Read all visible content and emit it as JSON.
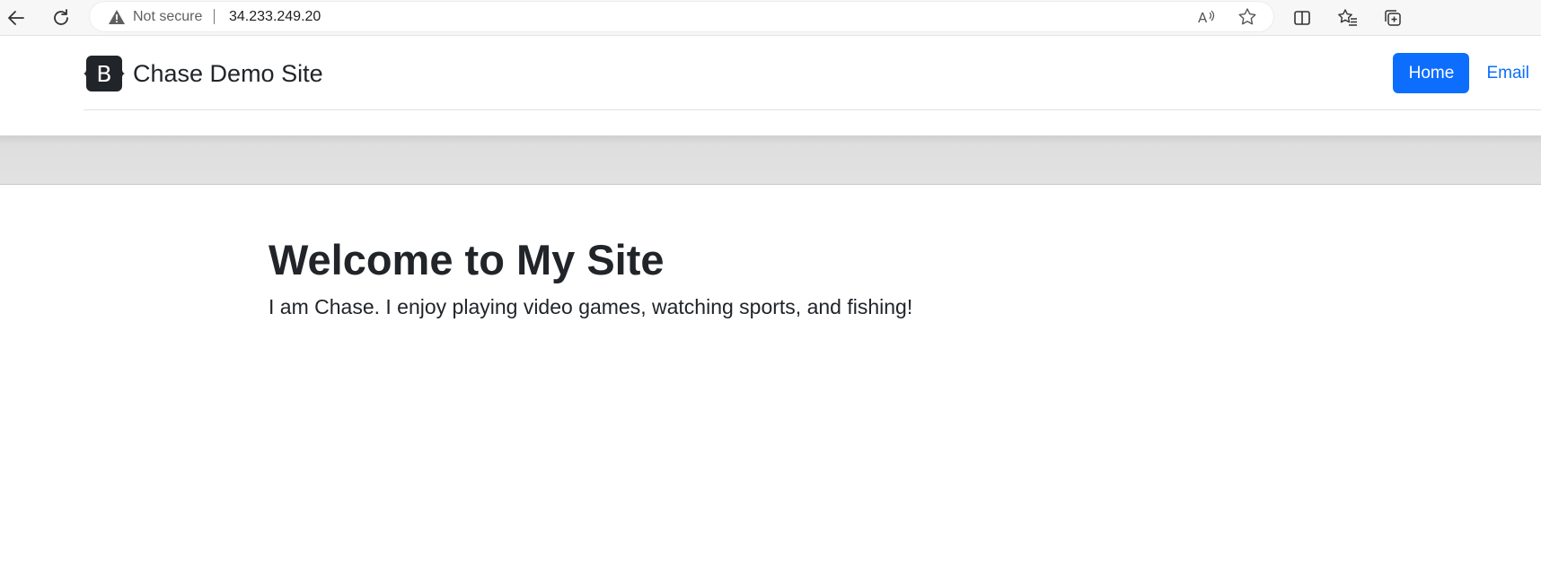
{
  "browser": {
    "security_label": "Not secure",
    "url": "34.233.249.20",
    "icons": [
      "back-icon",
      "refresh-icon",
      "warning-icon",
      "read-aloud-icon",
      "favorite-star-icon",
      "split-screen-icon",
      "favorites-icon",
      "collections-icon"
    ]
  },
  "header": {
    "brand_letter": "B",
    "brand_name": "Chase Demo Site",
    "nav": {
      "home_label": "Home",
      "email_label": "Email"
    },
    "accent_color": "#0d6efd"
  },
  "main": {
    "title": "Welcome to My Site",
    "lead": "I am Chase. I enjoy playing video games, watching sports, and fishing!"
  }
}
